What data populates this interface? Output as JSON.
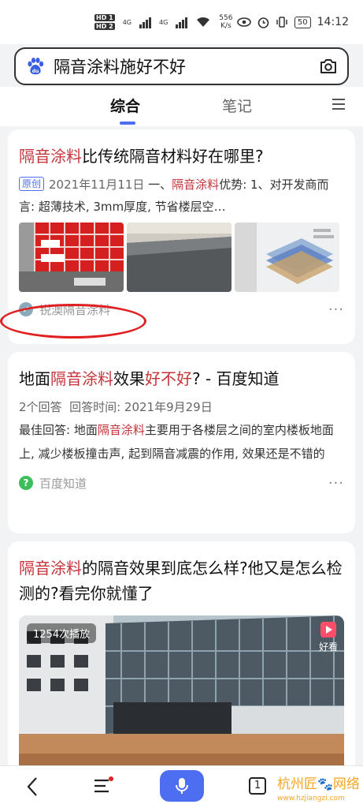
{
  "status_bar": {
    "hd1": "HD 1",
    "hd2": "HD 2",
    "net1": "4G",
    "net2": "4G",
    "speed": "556",
    "speed_unit": "K/s",
    "battery": "50",
    "time": "14:12"
  },
  "search": {
    "query": "隔音涂料施好不好"
  },
  "tabs": {
    "active": "综合",
    "second": "笔记"
  },
  "results": [
    {
      "title_hl": "隔音涂料",
      "title_rest": "比传统隔音材料好在哪里?",
      "tag": "原创",
      "date": "2021年11月11日",
      "snippet_pre": "一、",
      "snippet_hl": "隔音涂料",
      "snippet_post": "优势: 1、对开发商而言: 超薄技术, 3mm厚度, 节省楼层空…",
      "source": "锐澳隔音涂料",
      "more": "···"
    },
    {
      "title_pre": "地面",
      "title_hl": "隔音涂料",
      "title_mid": "效果",
      "title_hl2": "好不好",
      "title_post": "? - 百度知道",
      "answers": "2个回答",
      "answer_time": "回答时间: 2021年9月29日",
      "body_pre": "最佳回答: 地面",
      "body_hl": "隔音涂料",
      "body_post": "主要用于各楼层之间的室内楼板地面上, 减少楼板撞击声, 起到隔音减震的作用, 效果还是不错的",
      "source": "百度知道",
      "more": "···"
    },
    {
      "title_hl": "隔音涂料",
      "title_rest": "的隔音效果到底怎么样?他又是怎么检测的?看完你就懂了",
      "play_count": "1254次播放",
      "video_brand": "好看"
    }
  ],
  "bottom_bar": {
    "tab_count": "1"
  },
  "watermark": {
    "main": "杭州匠",
    "sub": "www.hzjiangzi.com",
    "tail": "网络"
  },
  "colors": {
    "accent": "#4e6ef2",
    "highlight": "#c5343a",
    "annotation": "#e02020"
  }
}
